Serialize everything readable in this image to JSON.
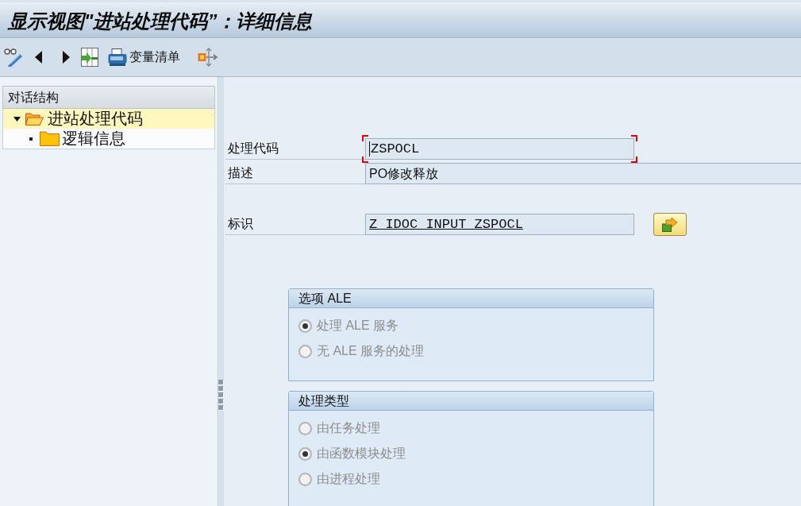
{
  "window": {
    "title": "显示视图\"进站处理代码”：详细信息"
  },
  "toolbar": {
    "buttons": [
      {
        "label": "变量清单"
      }
    ]
  },
  "dialog_structure": {
    "title": "对话结构",
    "tree": [
      {
        "label": "进站处理代码",
        "selected": true,
        "expanded": true,
        "children": [
          {
            "label": "逻辑信息",
            "selected": false
          }
        ]
      }
    ]
  },
  "form": {
    "header_fields": [
      {
        "label": "处理代码",
        "value": "ZSPOCL",
        "kind": "field",
        "focused": true
      },
      {
        "label": "描述",
        "value": "PO修改释放",
        "kind": "wide_field",
        "focused": false
      }
    ],
    "detail_fields": [
      {
        "label": "标识",
        "value": "Z_IDOC_INPUT_ZSPOCL",
        "kind": "link_field",
        "focused": false
      }
    ]
  },
  "groups": [
    {
      "title": "选项 ALE",
      "options": [
        {
          "label": "处理 ALE 服务",
          "selected": true,
          "disabled": true
        },
        {
          "label": "无 ALE 服务的处理",
          "selected": false,
          "disabled": true
        }
      ]
    },
    {
      "title": "处理类型",
      "options": [
        {
          "label": "由任务处理",
          "selected": false,
          "disabled": true
        },
        {
          "label": "由函数模块处理",
          "selected": true,
          "disabled": true
        },
        {
          "label": "由进程处理",
          "selected": false,
          "disabled": true
        }
      ]
    }
  ]
}
